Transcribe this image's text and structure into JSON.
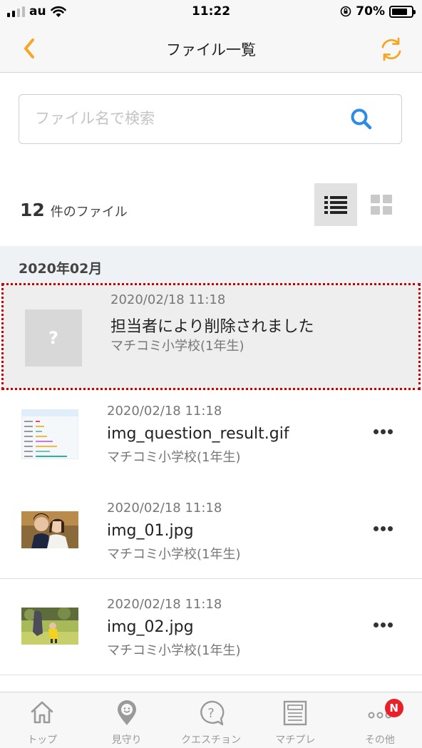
{
  "status_bar": {
    "carrier": "au",
    "time": "11:22",
    "battery": "70%"
  },
  "nav": {
    "title": "ファイル一覧",
    "back_icon": "chevron-left-icon",
    "refresh_icon": "refresh-icon"
  },
  "search": {
    "placeholder": "ファイル名で検索",
    "value": ""
  },
  "summary": {
    "count": "12",
    "count_label": "件のファイル"
  },
  "section": {
    "title": "2020年02月"
  },
  "files": [
    {
      "date": "2020/02/18 11:18",
      "name": "担当者により削除されました",
      "school": "マチコミ小学校(1年生)",
      "thumb": "?"
    },
    {
      "date": "2020/02/18 11:18",
      "name": "img_question_result.gif",
      "school": "マチコミ小学校(1年生)"
    },
    {
      "date": "2020/02/18 11:18",
      "name": "img_01.jpg",
      "school": "マチコミ小学校(1年生)"
    },
    {
      "date": "2020/02/18 11:18",
      "name": "img_02.jpg",
      "school": "マチコミ小学校(1年生)"
    }
  ],
  "tabs": [
    {
      "label": "トップ",
      "icon": "home-icon"
    },
    {
      "label": "見守り",
      "icon": "location-pin-icon"
    },
    {
      "label": "クエスチョン",
      "icon": "question-bubble-icon"
    },
    {
      "label": "マチプレ",
      "icon": "newspaper-icon"
    },
    {
      "label": "その他",
      "icon": "more-icon",
      "badge": "N"
    }
  ],
  "colors": {
    "accent": "#f5a623",
    "search_icon": "#2b8be6",
    "badge": "#e8202a",
    "deleted_border": "#cc0000"
  }
}
